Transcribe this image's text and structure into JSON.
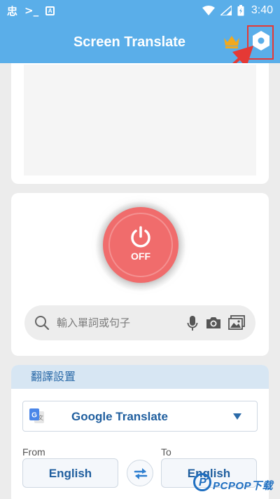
{
  "status_bar": {
    "left_glyphs": [
      "忠",
      ">_",
      "A"
    ],
    "time": "3:40"
  },
  "app_bar": {
    "title": "Screen Translate",
    "crown_icon": "crown-icon",
    "settings_icon": "settings-hexagon-icon"
  },
  "power": {
    "label": "OFF",
    "state": "off",
    "color": "#f06c6c"
  },
  "search": {
    "placeholder": "輸入單詞或句子",
    "icons": [
      "search-icon",
      "mic-icon",
      "camera-icon",
      "image-icon"
    ]
  },
  "settings_section": {
    "title": "翻譯設置",
    "engine": "Google Translate",
    "from_label": "From",
    "to_label": "To",
    "from_language": "English",
    "to_language": "English"
  },
  "watermark": {
    "text": "PCPOP下载"
  },
  "colors": {
    "primary": "#5aaee9",
    "accent_blue": "#1f5e9e",
    "annotation_red": "#e53935",
    "crown": "#f2a91e"
  }
}
